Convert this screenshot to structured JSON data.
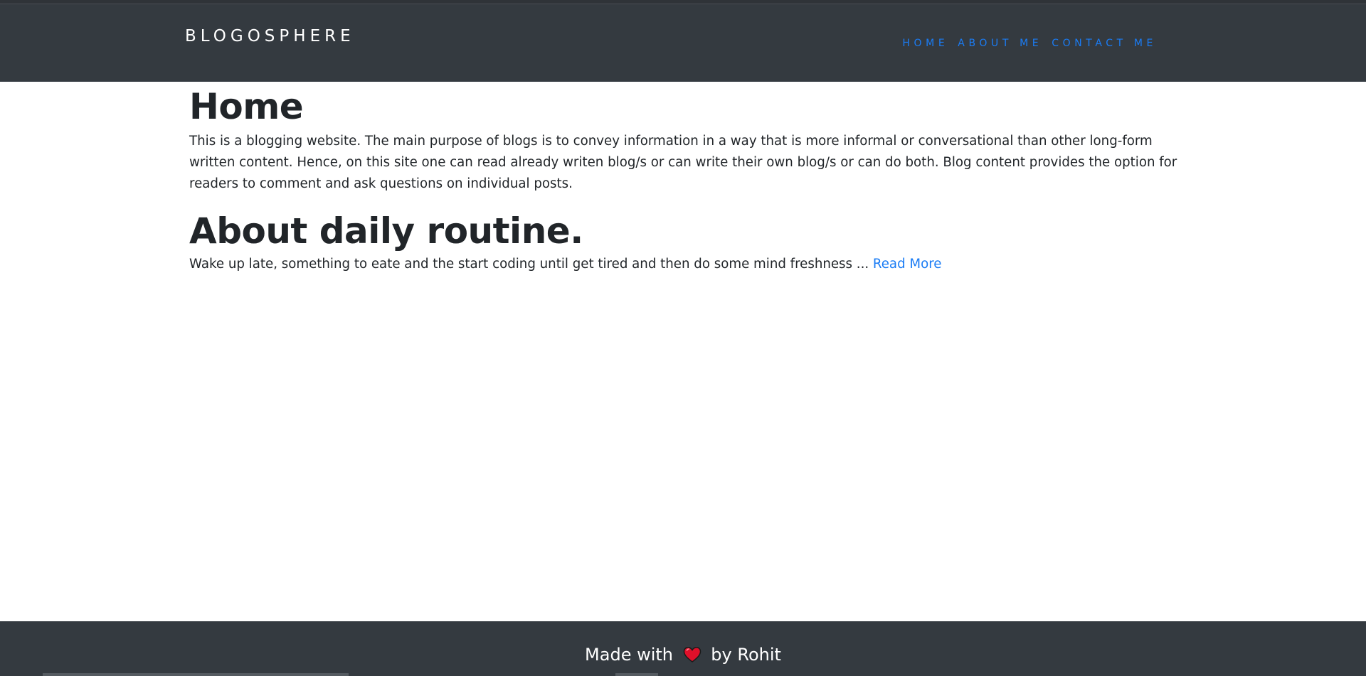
{
  "header": {
    "brand": "BLOGOSPHERE",
    "nav": [
      "HOME",
      "ABOUT ME",
      "CONTACT ME"
    ]
  },
  "main": {
    "title": "Home",
    "intro": "This is a blogging website. The main purpose of blogs is to convey information in a way that is more informal or conversational than other long-form written content. Hence, on this site one can read already writen blog/s or can write their own blog/s or can do both. Blog content provides the option for readers to comment and ask questions on individual posts.",
    "posts": [
      {
        "title": "About daily routine.",
        "excerpt": "Wake up late, something to eate and the start coding until get tired and then do some mind freshness ... ",
        "read_more": "Read More"
      }
    ]
  },
  "footer": {
    "before": "Made with",
    "icon": "heart-icon",
    "after": "by Rohit"
  },
  "colors": {
    "navbar": "#343a40",
    "link": "#1a7cf5",
    "heart": "#e0102a"
  }
}
